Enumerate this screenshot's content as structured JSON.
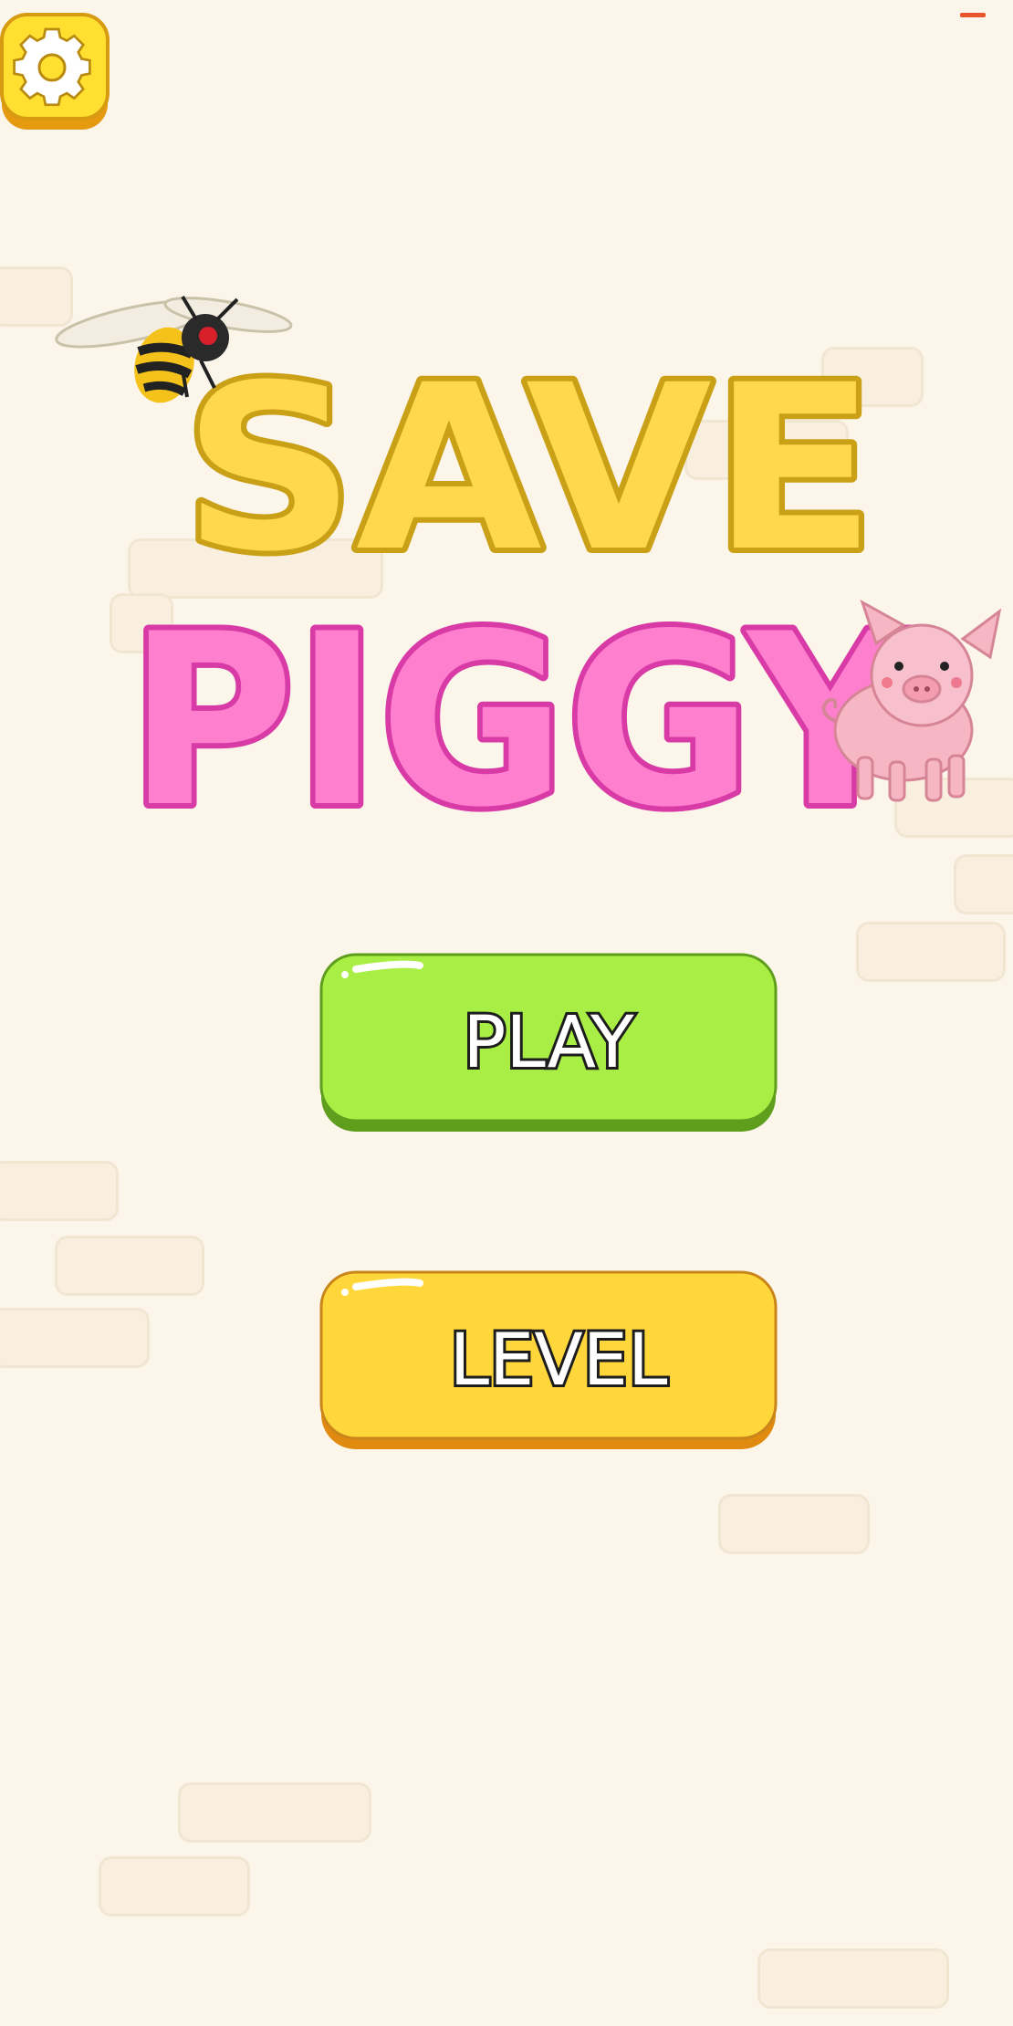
{
  "title": {
    "line1": "SAVE",
    "line2": "PIGGY"
  },
  "buttons": {
    "play": "PLAY",
    "level": "LEVEL"
  },
  "colors": {
    "background": "#fcf5ea",
    "title_yellow": "#ffd84d",
    "title_yellow_outline": "#c9a016",
    "title_pink": "#ff7fcf",
    "title_pink_outline": "#d83aa6",
    "play_green": "#a8ee44",
    "level_yellow": "#ffd73b",
    "settings_yellow": "#ffe030"
  },
  "icons": {
    "settings": "gear-icon",
    "bee": "bee-icon",
    "pig": "pig-icon"
  }
}
